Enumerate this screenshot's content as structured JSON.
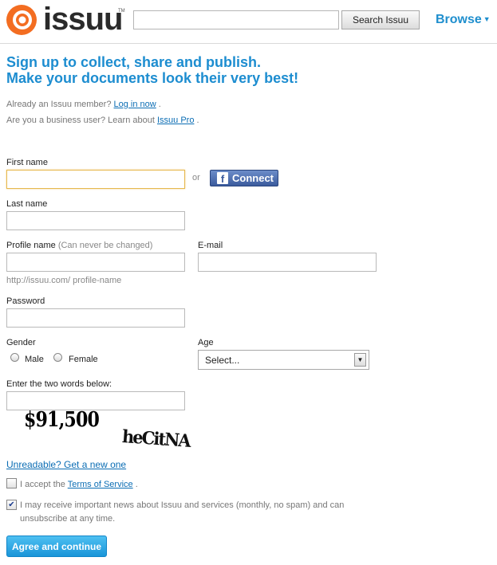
{
  "header": {
    "logo_text": "issuu",
    "logo_tm": "TM",
    "search_value": "",
    "search_button": "Search Issuu",
    "browse_label": "Browse"
  },
  "headline": {
    "line1": "Sign up to collect, share and publish.",
    "line2": "Make your documents look their very best!"
  },
  "intro": {
    "member_text": "Already an Issuu member?",
    "login_link": "Log in now",
    "member_suffix": ".",
    "business_text": "Are you a business user? Learn about",
    "pro_link": "Issuu Pro",
    "business_suffix": "."
  },
  "form": {
    "first_name_label": "First name",
    "first_name_value": "",
    "or_text": "or",
    "connect_label": "Connect",
    "facebook_glyph": "f",
    "last_name_label": "Last name",
    "last_name_value": "",
    "profile_name_label": "Profile name",
    "profile_name_hint": "(Can never be changed)",
    "profile_name_value": "",
    "profile_url_note": "http://issuu.com/ profile-name",
    "email_label": "E-mail",
    "email_value": "",
    "password_label": "Password",
    "password_value": "",
    "gender_label": "Gender",
    "gender_male": "Male",
    "gender_female": "Female",
    "age_label": "Age",
    "age_selected": "Select...",
    "captcha_label": "Enter the two words below:",
    "captcha_value": "",
    "captcha_word1": "$91,500",
    "captcha_word2": "heCitNA",
    "unreadable_link": "Unreadable? Get a new one",
    "accept_prefix": "I accept the",
    "tos_link": "Terms of Service",
    "accept_suffix": ".",
    "accept_checked": false,
    "news_text": "I may receive important news about Issuu and services (monthly, no spam) and can unsubscribe at any time.",
    "news_checked": true,
    "submit_label": "Agree and continue"
  },
  "colors": {
    "accent": "#1d8dd0",
    "link": "#0b6db4",
    "facebook": "#3b5b9d",
    "logo_orange": "#f36d21"
  }
}
